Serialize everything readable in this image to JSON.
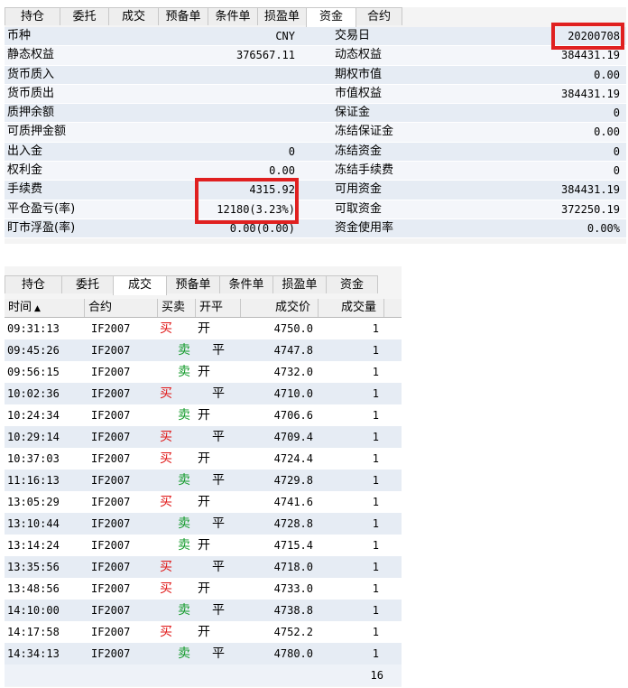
{
  "fund": {
    "tabs": [
      "持仓",
      "委托",
      "成交",
      "预备单",
      "条件单",
      "损盈单",
      "资金",
      "合约"
    ],
    "active_tab": "资金",
    "rows": [
      {
        "l1": "币种",
        "v1": "CNY",
        "l2": "交易日",
        "v2": "20200708"
      },
      {
        "l1": "静态权益",
        "v1": "376567.11",
        "l2": "动态权益",
        "v2": "384431.19"
      },
      {
        "l1": "货币质入",
        "v1": "",
        "l2": "期权市值",
        "v2": "0.00"
      },
      {
        "l1": "货币质出",
        "v1": "",
        "l2": "市值权益",
        "v2": "384431.19"
      },
      {
        "l1": "质押余额",
        "v1": "",
        "l2": "保证金",
        "v2": "0"
      },
      {
        "l1": "可质押金额",
        "v1": "",
        "l2": "冻结保证金",
        "v2": "0.00"
      },
      {
        "l1": "出入金",
        "v1": "0",
        "l2": "冻结资金",
        "v2": "0"
      },
      {
        "l1": "权利金",
        "v1": "0.00",
        "l2": "冻结手续费",
        "v2": "0"
      },
      {
        "l1": "手续费",
        "v1": "4315.92",
        "l2": "可用资金",
        "v2": "384431.19"
      },
      {
        "l1": "平仓盈亏(率)",
        "v1": "12180(3.23%)",
        "l2": "可取资金",
        "v2": "372250.19"
      },
      {
        "l1": "盯市浮盈(率)",
        "v1": "0.00(0.00)",
        "l2": "资金使用率",
        "v2": "0.00%"
      }
    ]
  },
  "trades": {
    "tabs": [
      "持仓",
      "委托",
      "成交",
      "预备单",
      "条件单",
      "损盈单",
      "资金"
    ],
    "active_tab": "成交",
    "columns": {
      "time": "时间",
      "contract": "合约",
      "side": "买卖",
      "open_close": "开平",
      "price": "成交价",
      "qty": "成交量"
    },
    "sort_arrow": "▲",
    "rows": [
      {
        "time": "09:31:13",
        "contract": "IF2007",
        "side": "买",
        "oc": "开",
        "price": "4750.0",
        "qty": "1"
      },
      {
        "time": "09:45:26",
        "contract": "IF2007",
        "side": "卖",
        "oc": "平",
        "price": "4747.8",
        "qty": "1"
      },
      {
        "time": "09:56:15",
        "contract": "IF2007",
        "side": "卖",
        "oc": "开",
        "price": "4732.0",
        "qty": "1"
      },
      {
        "time": "10:02:36",
        "contract": "IF2007",
        "side": "买",
        "oc": "平",
        "price": "4710.0",
        "qty": "1"
      },
      {
        "time": "10:24:34",
        "contract": "IF2007",
        "side": "卖",
        "oc": "开",
        "price": "4706.6",
        "qty": "1"
      },
      {
        "time": "10:29:14",
        "contract": "IF2007",
        "side": "买",
        "oc": "平",
        "price": "4709.4",
        "qty": "1"
      },
      {
        "time": "10:37:03",
        "contract": "IF2007",
        "side": "买",
        "oc": "开",
        "price": "4724.4",
        "qty": "1"
      },
      {
        "time": "11:16:13",
        "contract": "IF2007",
        "side": "卖",
        "oc": "平",
        "price": "4729.8",
        "qty": "1"
      },
      {
        "time": "13:05:29",
        "contract": "IF2007",
        "side": "买",
        "oc": "开",
        "price": "4741.6",
        "qty": "1"
      },
      {
        "time": "13:10:44",
        "contract": "IF2007",
        "side": "卖",
        "oc": "平",
        "price": "4728.8",
        "qty": "1"
      },
      {
        "time": "13:14:24",
        "contract": "IF2007",
        "side": "卖",
        "oc": "开",
        "price": "4715.4",
        "qty": "1"
      },
      {
        "time": "13:35:56",
        "contract": "IF2007",
        "side": "买",
        "oc": "平",
        "price": "4718.0",
        "qty": "1"
      },
      {
        "time": "13:48:56",
        "contract": "IF2007",
        "side": "买",
        "oc": "开",
        "price": "4733.0",
        "qty": "1"
      },
      {
        "time": "14:10:00",
        "contract": "IF2007",
        "side": "卖",
        "oc": "平",
        "price": "4738.8",
        "qty": "1"
      },
      {
        "time": "14:17:58",
        "contract": "IF2007",
        "side": "买",
        "oc": "开",
        "price": "4752.2",
        "qty": "1"
      },
      {
        "time": "14:34:13",
        "contract": "IF2007",
        "side": "卖",
        "oc": "平",
        "price": "4780.0",
        "qty": "1"
      }
    ],
    "total_qty": "16"
  },
  "colors": {
    "buy": "#e01818",
    "sell": "#129a2a",
    "highlight": "#e02020"
  }
}
